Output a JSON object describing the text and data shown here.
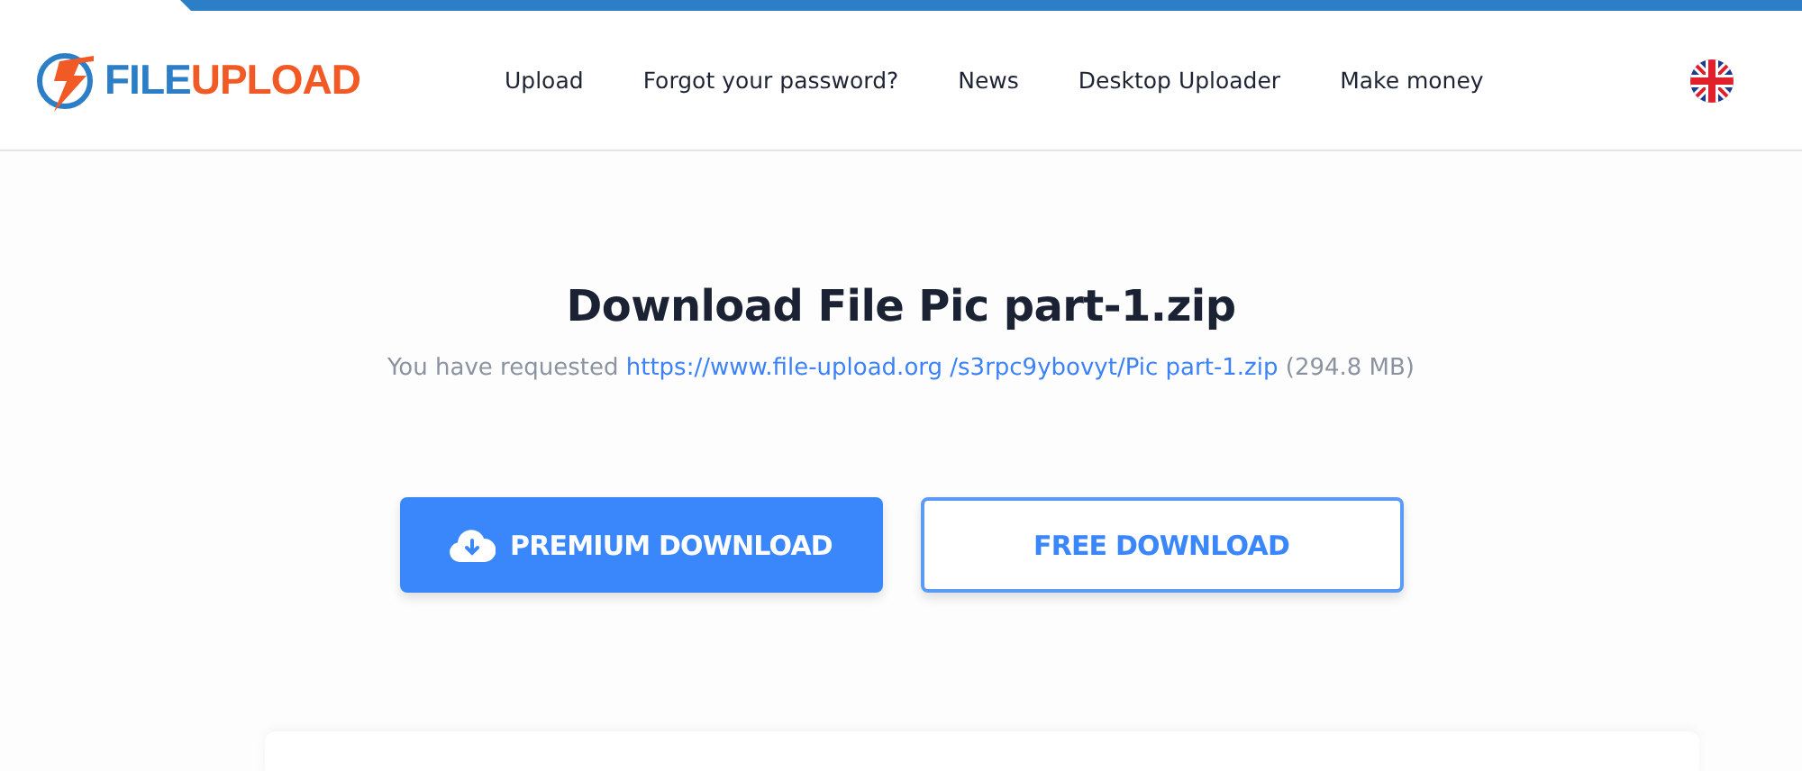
{
  "logo": {
    "part_1": "FILE",
    "part_2": "UPLOAD"
  },
  "nav": [
    {
      "label": "Upload"
    },
    {
      "label": "Forgot your password?"
    },
    {
      "label": "News"
    },
    {
      "label": "Desktop Uploader"
    },
    {
      "label": "Make money"
    }
  ],
  "title": "Download File Pic part-1.zip",
  "request": {
    "prefix": "You have requested",
    "link": "https://www.file-upload.org /s3rpc9ybovyt/Pic part-1.zip",
    "size": "(294.8 MB)"
  },
  "buttons": [
    {
      "kind": "primary",
      "label": "PREMIUM DOWNLOAD"
    },
    {
      "kind": "outline",
      "label": "FREE DOWNLOAD"
    }
  ]
}
